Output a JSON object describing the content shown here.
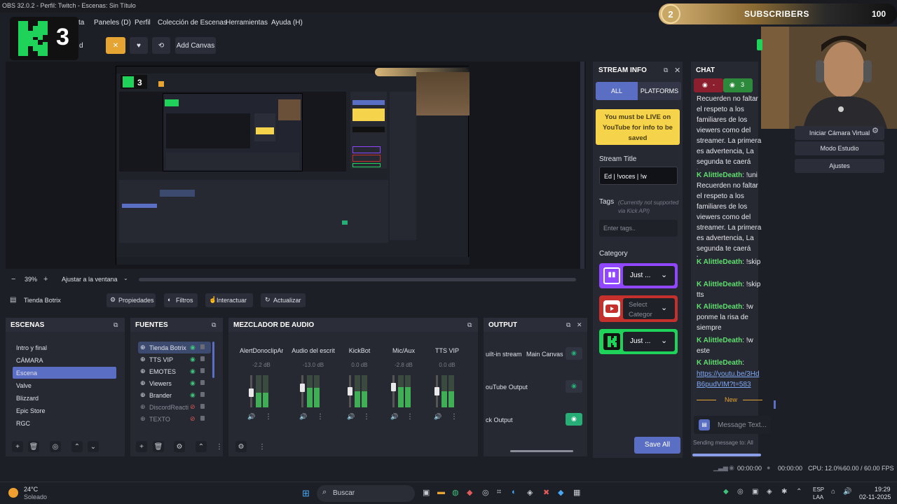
{
  "window": {
    "title": "OBS 32.0.2 - Perfil: Twitch - Escenas: Sin Título"
  },
  "menu": [
    "ta",
    "Paneles (D)",
    "Perfil",
    "Colección de Escenas",
    "Herramientas",
    "Ayuda (H)"
  ],
  "toolbar": {
    "partial_label": "d",
    "add_canvas": "Add Canvas"
  },
  "overlay": {
    "logo_number": "3",
    "subs_badge": "2",
    "subs_label": "SUBSCRIBERS",
    "subs_count": "100"
  },
  "preview": {
    "zoom": "39%",
    "fit_label": "Ajustar a la ventana",
    "colors": {
      "brand_green": "#1fd25a",
      "accent": "#5a6ec4",
      "orange": "#e6a532"
    }
  },
  "source_toolbar": {
    "current_source": "Tienda Botrix",
    "properties": "Propiedades",
    "filters": "Filtros",
    "interact": "Interactuar",
    "refresh": "Actualizar"
  },
  "scenes": {
    "title": "ESCENAS",
    "items": [
      "Intro y final",
      "CÁMARA",
      "Escena",
      "Valve",
      "Blizzard",
      "Epic Store",
      "RGC"
    ],
    "selected": 2
  },
  "sources": {
    "title": "FUENTES",
    "items": [
      {
        "name": "Tienda Botrix",
        "visible": true
      },
      {
        "name": "TTS VIP",
        "visible": true
      },
      {
        "name": "EMOTES",
        "visible": true
      },
      {
        "name": "Viewers",
        "visible": true
      },
      {
        "name": "Brander",
        "visible": true
      },
      {
        "name": "DiscordReactive",
        "visible": false
      },
      {
        "name": "TEXTO",
        "visible": false
      }
    ]
  },
  "mixer": {
    "title": "MEZCLADOR DE AUDIO",
    "channels": [
      {
        "name": "AlertDonoclipAr",
        "db": "-2.2 dB",
        "level": 0.45
      },
      {
        "name": "Audio del escrit",
        "db": "-13.0 dB",
        "level": 0.6
      },
      {
        "name": "KickBot",
        "db": "0.0 dB",
        "level": 0.5
      },
      {
        "name": "Mic/Aux",
        "db": "-2.8 dB",
        "level": 0.62
      },
      {
        "name": "TTS VIP",
        "db": "0.0 dB",
        "level": 0.5
      }
    ]
  },
  "output": {
    "title": "OUTPUT",
    "rows": [
      {
        "name": "uilt-in stream",
        "canvas": "Main Canvas",
        "on": false
      },
      {
        "name": "ouTube Output",
        "canvas": "",
        "on": false
      },
      {
        "name": "ck Output",
        "canvas": "",
        "on": true
      }
    ]
  },
  "stream_info": {
    "title": "STREAM INFO",
    "tab_all": "ALL",
    "tab_platforms": "PLATFORMS",
    "warning": "You must be LIVE on YouTube for info to be saved",
    "stream_title_label": "Stream Title",
    "stream_title_value": "Ed | !voces | !w",
    "tags_label": "Tags",
    "tags_note": "(Currently not supported via Kick API)",
    "tags_placeholder": "Enter tags..",
    "category_label": "Category",
    "categories": [
      {
        "platform": "twitch",
        "value": "Just ...",
        "color": "#9146ff"
      },
      {
        "platform": "youtube",
        "value": "Select Categor",
        "color": "#c4302b"
      },
      {
        "platform": "kick",
        "value": "Just ...",
        "color": "#53fc18"
      }
    ],
    "save_all": "Save All"
  },
  "chat": {
    "title": "CHAT",
    "viewer_red": "-",
    "viewer_green": "3",
    "messages": [
      {
        "user": "",
        "text": "Recuerden no faltar el respeto a los familiares de los viewers como del streamer. La primera es advertencia, La segunda te caerá ban"
      },
      {
        "user": "AlittleDeath",
        "text": ": !uni Recuerden no faltar el respeto a los familiares de los viewers como del streamer. La primera es advertencia, La segunda te caerá ban"
      },
      {
        "user": "AlittleDeath",
        "text": ": !skip"
      },
      {
        "user": "AlittleDeath",
        "text": ": !skip tts"
      },
      {
        "user": "AlittleDeath",
        "text": ": !w ponme la risa de siempre"
      },
      {
        "user": "AlittleDeath",
        "text": ": !w este"
      },
      {
        "user": "AlittleDeath",
        "text": ":"
      }
    ],
    "link": "https://youtu.be/3HdB6pudVIM?t=583",
    "new_label": "New",
    "input_placeholder": "Message Text...",
    "sending_to": "Sending message to: All"
  },
  "controls": {
    "virtual_cam": "Iniciar Cámara Virtual",
    "studio_mode": "Modo Estudio",
    "settings": "Ajustes"
  },
  "status": {
    "time1": "00:00:00",
    "time2": "00:00:00",
    "cpu": "CPU: 12.0%",
    "fps": "60.00 / 60.00 FPS"
  },
  "taskbar": {
    "temp": "24°C",
    "weather": "Soleado",
    "search": "Buscar",
    "lang1": "ESP",
    "lang2": "LAA",
    "clock": "19:29",
    "date": "02-11-2025"
  }
}
